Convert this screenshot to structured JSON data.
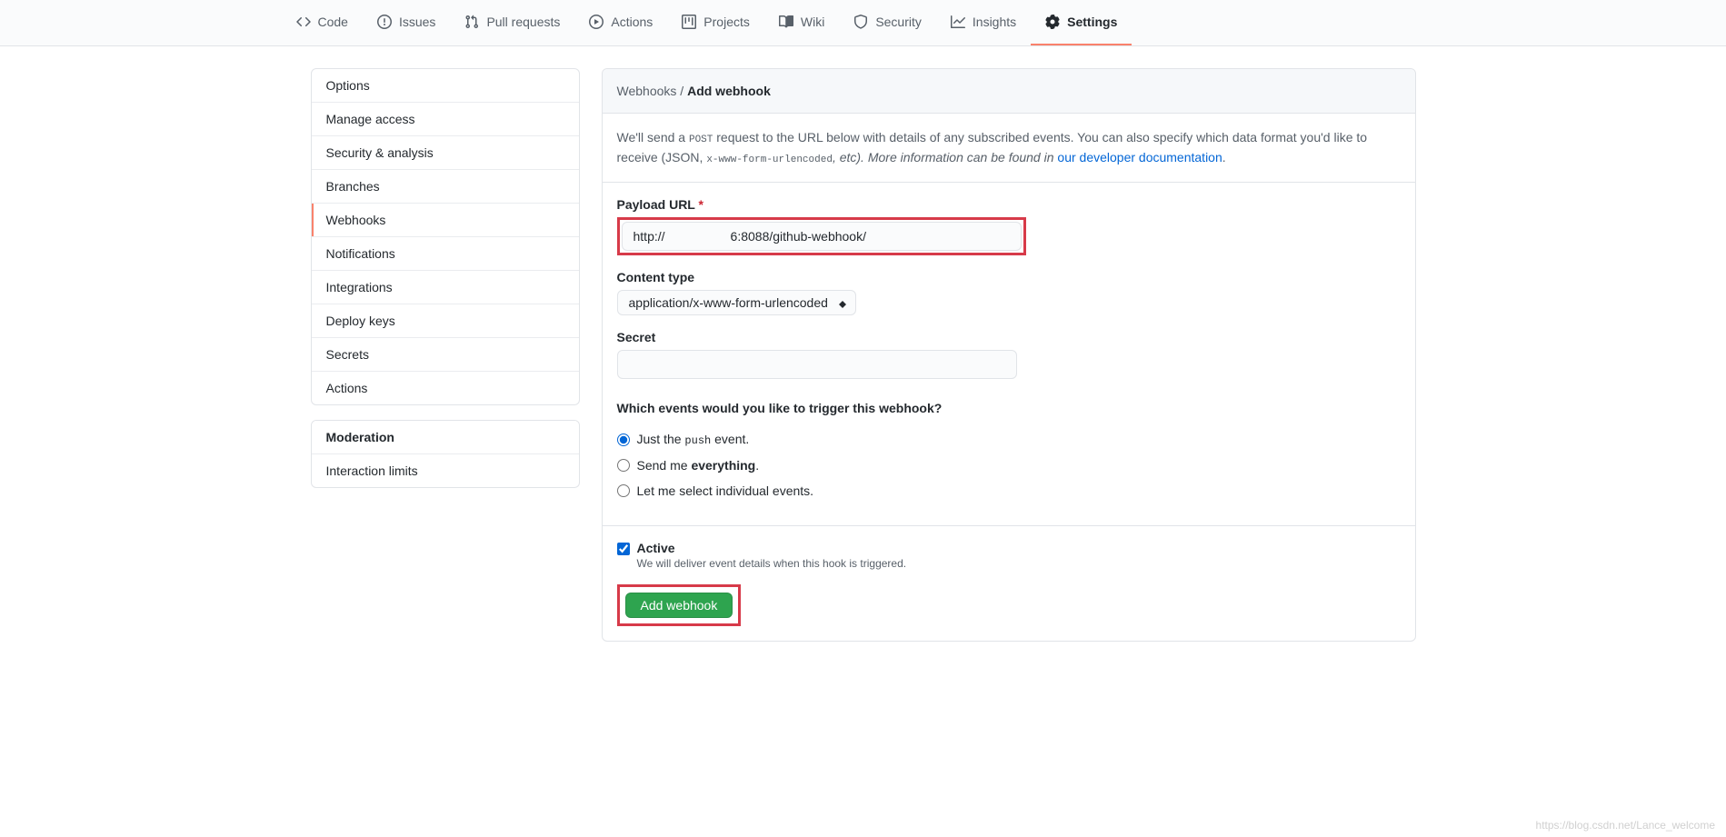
{
  "nav": {
    "tabs": [
      {
        "label": "Code"
      },
      {
        "label": "Issues"
      },
      {
        "label": "Pull requests"
      },
      {
        "label": "Actions"
      },
      {
        "label": "Projects"
      },
      {
        "label": "Wiki"
      },
      {
        "label": "Security"
      },
      {
        "label": "Insights"
      },
      {
        "label": "Settings"
      }
    ]
  },
  "sidebar": {
    "group1": [
      {
        "label": "Options"
      },
      {
        "label": "Manage access"
      },
      {
        "label": "Security & analysis"
      },
      {
        "label": "Branches"
      },
      {
        "label": "Webhooks"
      },
      {
        "label": "Notifications"
      },
      {
        "label": "Integrations"
      },
      {
        "label": "Deploy keys"
      },
      {
        "label": "Secrets"
      },
      {
        "label": "Actions"
      }
    ],
    "group2_header": "Moderation",
    "group2": [
      {
        "label": "Interaction limits"
      }
    ]
  },
  "breadcrumb": {
    "parent": "Webhooks",
    "sep": " / ",
    "current": "Add webhook"
  },
  "info": {
    "pre": "We'll send a ",
    "post_method": "POST",
    "post_text": " request to the URL below with details of any subscribed events. You can also specify which data format you'd like to receive (JSON, ",
    "content_type_code": "x-www-form-urlencoded",
    "etc": ", etc). More information can be found in ",
    "link": "our developer documentation",
    "period": "."
  },
  "form": {
    "payload_url_label": "Payload URL",
    "payload_url_value_pre": "http://",
    "payload_url_value_post": "6:8088/github-webhook/",
    "content_type_label": "Content type",
    "content_type_value": "application/x-www-form-urlencoded",
    "secret_label": "Secret",
    "secret_value": "",
    "events_heading": "Which events would you like to trigger this webhook?",
    "event_just_pre": "Just the ",
    "event_just_code": "push",
    "event_just_post": " event.",
    "event_everything_pre": "Send me ",
    "event_everything_strong": "everything",
    "event_everything_post": ".",
    "event_individual": "Let me select individual events.",
    "active_label": "Active",
    "active_note": "We will deliver event details when this hook is triggered.",
    "submit_label": "Add webhook"
  },
  "watermark": "https://blog.csdn.net/Lance_welcome"
}
